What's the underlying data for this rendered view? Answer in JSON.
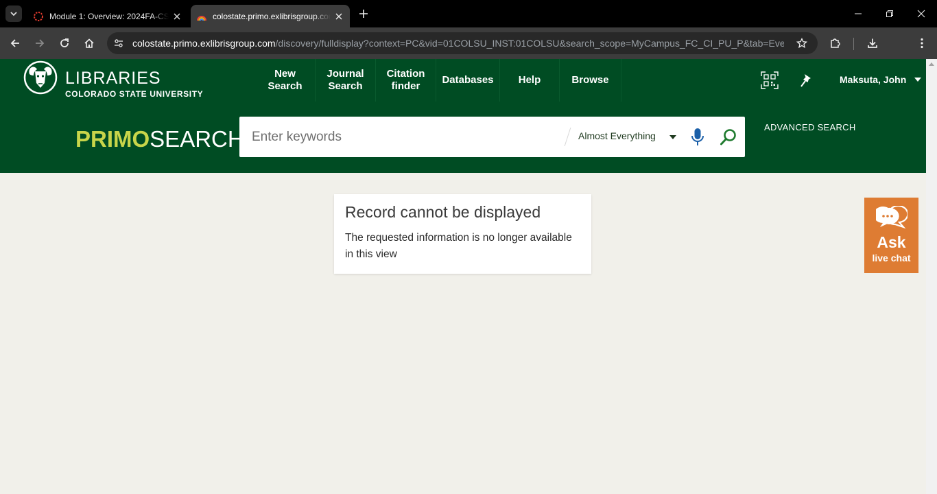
{
  "browser": {
    "tabs": [
      {
        "title": "Module 1: Overview: 2024FA-CS",
        "icon": "canvas-icon",
        "active": false
      },
      {
        "title": "colostate.primo.exlibrisgroup.com",
        "icon": "primo-icon",
        "active": true
      }
    ],
    "url": {
      "host": "colostate.primo.exlibrisgroup.com",
      "path": "/discovery/fulldisplay?context=PC&vid=01COLSU_INST:01COLSU&search_scope=MyCampus_FC_CI_PU_P&tab=Everyt..."
    }
  },
  "header": {
    "logo": {
      "title": "LIBRARIES",
      "subtitle": "COLORADO STATE UNIVERSITY"
    },
    "nav": [
      {
        "label_line1": "New",
        "label_line2": "Search"
      },
      {
        "label_line1": "Journal",
        "label_line2": "Search"
      },
      {
        "label_line1": "Citation",
        "label_line2": "finder"
      },
      {
        "label_line1": "Databases",
        "label_line2": ""
      },
      {
        "label_line1": "Help",
        "label_line2": ""
      },
      {
        "label_line1": "Browse",
        "label_line2": ""
      }
    ],
    "user_name": "Maksuta, John"
  },
  "search": {
    "brand_primary": "PRIMO",
    "brand_secondary": "SEARCH",
    "placeholder": "Enter keywords",
    "value": "",
    "scope": "Almost Everything",
    "advanced_label": "ADVANCED SEARCH"
  },
  "message": {
    "title": "Record cannot be displayed",
    "body": "The requested information is no longer available in this view"
  },
  "chat": {
    "ask": "Ask",
    "live": "live chat"
  },
  "colors": {
    "brand_green": "#004c23",
    "primo_accent": "#c8d54a",
    "chat_orange": "#de7c33",
    "page_bg": "#f1f0ea"
  }
}
